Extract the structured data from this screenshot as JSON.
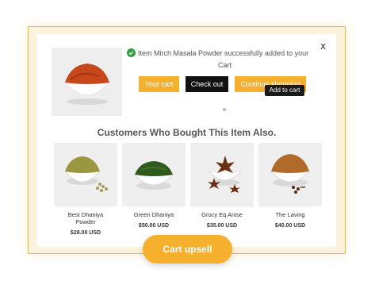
{
  "popup": {
    "close_label": "x",
    "message_line1": "Item Mirch Masala Powder successfully added to your",
    "message_line2": "Cart",
    "buttons": {
      "your_cart": "Your cart",
      "check_out": "Check out",
      "continue_shopping": "Continue shopping"
    },
    "tooltip": "Add to cart",
    "section_title": "Customers Who Bought This Item Also."
  },
  "products": [
    {
      "name": "Best Dhaniya\nPowder",
      "price": "$28.00 USD"
    },
    {
      "name": "Green Dhaniya",
      "price": "$50.00 USD"
    },
    {
      "name": "Grocy Eq Anise",
      "price": "$35.00 USD"
    },
    {
      "name": "The Laving",
      "price": "$40.00 USD"
    }
  ],
  "badge": {
    "label": "Cart upsell"
  },
  "colors": {
    "accent": "#f5b02e",
    "dark": "#111111",
    "success": "#2e9e3e"
  }
}
